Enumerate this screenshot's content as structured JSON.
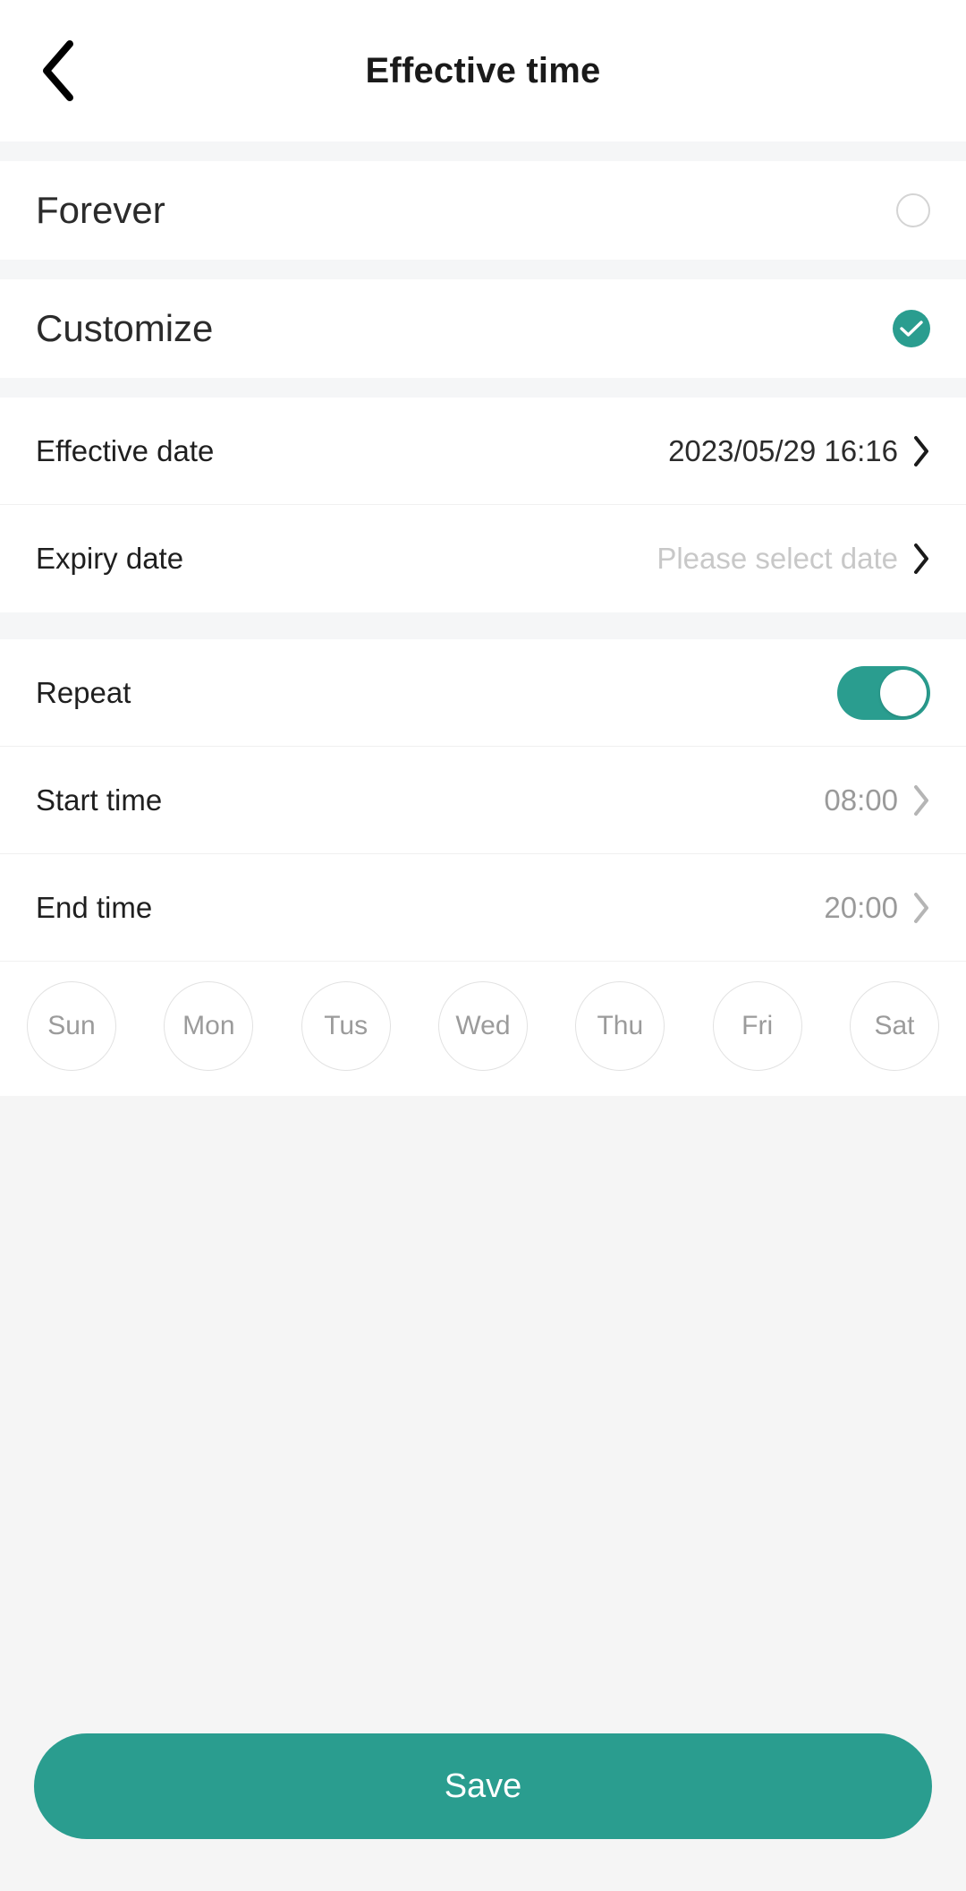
{
  "header": {
    "title": "Effective time",
    "back_icon": "chevron-left-icon"
  },
  "mode_options": [
    {
      "label": "Forever",
      "selected": false
    },
    {
      "label": "Customize",
      "selected": true
    }
  ],
  "date_section": [
    {
      "label": "Effective date",
      "value": "2023/05/29 16:16",
      "muted": false
    },
    {
      "label": "Expiry date",
      "value": "Please select date",
      "muted": true
    }
  ],
  "repeat_section": {
    "repeat_label": "Repeat",
    "repeat_on": true,
    "start_label": "Start time",
    "start_value": "08:00",
    "end_label": "End time",
    "end_value": "20:00"
  },
  "weekdays": [
    {
      "label": "Sun",
      "selected": false
    },
    {
      "label": "Mon",
      "selected": false
    },
    {
      "label": "Tus",
      "selected": false
    },
    {
      "label": "Wed",
      "selected": false
    },
    {
      "label": "Thu",
      "selected": false
    },
    {
      "label": "Fri",
      "selected": false
    },
    {
      "label": "Sat",
      "selected": false
    }
  ],
  "footer": {
    "save_label": "Save"
  },
  "colors": {
    "accent": "#2a9d8f",
    "page_bg": "#f5f5f5",
    "card_bg": "#ffffff",
    "text_primary": "#1f1f1f",
    "text_muted": "#c8c8c8",
    "text_grey": "#9a9a9a"
  }
}
